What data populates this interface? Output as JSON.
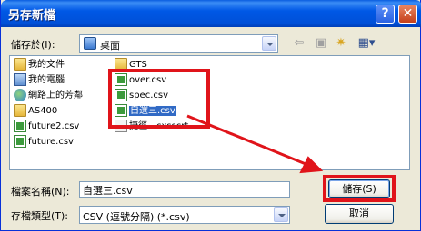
{
  "window": {
    "title": "另存新檔",
    "help_label": "?",
    "close_label": "✕"
  },
  "location": {
    "label": "儲存於(I):",
    "value": "桌面"
  },
  "toolbar": {
    "back_icon": "back-arrow-icon",
    "up_icon": "up-folder-icon",
    "new_folder_icon": "new-folder-icon",
    "view_icon": "view-menu-icon"
  },
  "files": [
    {
      "name": "我的文件",
      "type": "folder"
    },
    {
      "name": "我的電腦",
      "type": "computer"
    },
    {
      "name": "網路上的芳鄰",
      "type": "network"
    },
    {
      "name": "AS400",
      "type": "folder"
    },
    {
      "name": "future2.csv",
      "type": "csv"
    },
    {
      "name": "future.csv",
      "type": "csv"
    },
    {
      "name": "GTS",
      "type": "folder"
    },
    {
      "name": "over.csv",
      "type": "csv"
    },
    {
      "name": "spec.csv",
      "type": "csv"
    },
    {
      "name": "自選三.csv",
      "type": "csv",
      "selected": true
    },
    {
      "name": "捷徑 - cxsscrt",
      "type": "shortcut"
    }
  ],
  "filename": {
    "label": "檔案名稱(N):",
    "value": "自選三.csv"
  },
  "filetype": {
    "label": "存檔類型(T):",
    "value": "CSV (逗號分隔) (*.csv)"
  },
  "buttons": {
    "save": "儲存(S)",
    "cancel": "取消"
  },
  "colors": {
    "highlight": "#e0141a",
    "selection": "#316ac5"
  }
}
